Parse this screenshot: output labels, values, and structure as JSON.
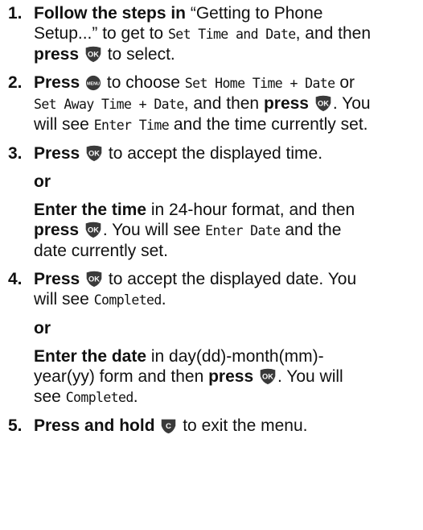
{
  "icons": {
    "ok": "ok-button-icon",
    "menu": "menu-button-icon",
    "clear": "c-button-icon"
  },
  "step1": {
    "num": "1.",
    "bold_start": "Follow the steps in",
    "text_a": " “Getting to Phone",
    "text_b": "Setup...” to get to ",
    "lcd_a": "Set Time and Date",
    "text_c": ", and then",
    "bold_press": "press",
    "text_d": " to select."
  },
  "step2": {
    "num": "2.",
    "bold_press": "Press",
    "text_a": " to choose ",
    "lcd_a": "Set Home Time + Date",
    "text_b": " or",
    "lcd_b": "Set Away Time + Date",
    "text_c": ", and then ",
    "bold_press2": "press",
    "text_d": ". You",
    "text_e": "will see ",
    "lcd_c": "Enter Time",
    "text_f": " and the time currently set."
  },
  "step3": {
    "num": "3.",
    "bold_press": "Press",
    "text_a": " to accept the displayed time.",
    "or": "or",
    "bold_enter": "Enter the time",
    "text_b": " in 24-hour format, and then",
    "bold_press2": "press",
    "text_c": ". You will see ",
    "lcd_a": "Enter Date",
    "text_d": " and the",
    "text_e": "date currently set."
  },
  "step4": {
    "num": "4.",
    "bold_press": "Press",
    "text_a": " to accept the displayed date. You",
    "text_b": "will see ",
    "lcd_a": "Completed",
    "text_c": ".",
    "or": "or",
    "bold_enter": "Enter the date",
    "text_d": " in day(dd)-month(mm)-",
    "text_e": "year(yy) form and then ",
    "bold_press2": "press",
    "text_f": ". You will",
    "text_g": "see ",
    "lcd_b": "Completed",
    "text_h": "."
  },
  "step5": {
    "num": "5.",
    "bold_press": "Press and hold",
    "text_a": " to exit the menu."
  }
}
